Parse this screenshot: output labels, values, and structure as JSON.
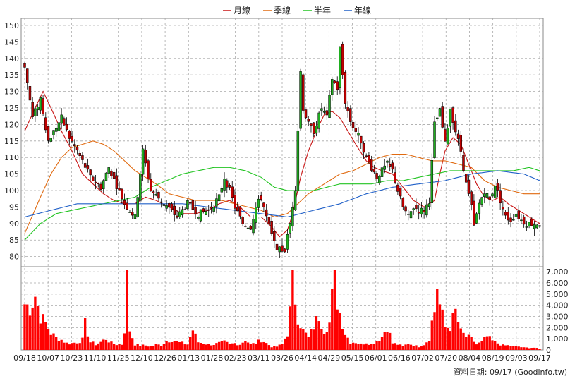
{
  "chart_data": {
    "type": "candlestick",
    "title": "",
    "legend": {
      "placement": "top-center",
      "items": [
        {
          "label": "月線",
          "color": "#c81414"
        },
        {
          "label": "季線",
          "color": "#e06a10"
        },
        {
          "label": "半年",
          "color": "#22c422"
        },
        {
          "label": "年線",
          "color": "#2060c8"
        }
      ]
    },
    "price_axis": {
      "ylim": [
        78,
        150
      ],
      "ticks": [
        80,
        85,
        90,
        95,
        100,
        105,
        110,
        115,
        120,
        125,
        130,
        135,
        140,
        145,
        150
      ],
      "placement": "left"
    },
    "volume_axis": {
      "ylim": [
        0,
        7200
      ],
      "ticks": [
        "0",
        "1,000",
        "2,000",
        "3,000",
        "4,000",
        "5,000",
        "6,000",
        "7,000"
      ],
      "tick_values": [
        0,
        1000,
        2000,
        3000,
        4000,
        5000,
        6000,
        7000
      ],
      "placement": "right"
    },
    "grid": true,
    "x_ticks": [
      "09/18",
      "10/07",
      "10/23",
      "11/10",
      "11/25",
      "12/10",
      "12/26",
      "01/13",
      "01/28",
      "02/23",
      "03/11",
      "03/26",
      "04/14",
      "04/29",
      "05/15",
      "06/01",
      "06/16",
      "07/02",
      "07/20",
      "08/04",
      "08/19",
      "09/03",
      "09/17"
    ],
    "colors": {
      "up": "#1fae1f",
      "down": "#c00000",
      "volume": "#ff0000",
      "grid": "#a8a8a8"
    },
    "close_anchors": [
      [
        0,
        138
      ],
      [
        3,
        122
      ],
      [
        6,
        128
      ],
      [
        9,
        115
      ],
      [
        14,
        122
      ],
      [
        17,
        116
      ],
      [
        20,
        112
      ],
      [
        25,
        104
      ],
      [
        29,
        101
      ],
      [
        32,
        107
      ],
      [
        38,
        96
      ],
      [
        42,
        92
      ],
      [
        45,
        112
      ],
      [
        48,
        100
      ],
      [
        52,
        97
      ],
      [
        58,
        92
      ],
      [
        62,
        96
      ],
      [
        66,
        93
      ],
      [
        70,
        94
      ],
      [
        74,
        98
      ],
      [
        76,
        104
      ],
      [
        78,
        100
      ],
      [
        80,
        95
      ],
      [
        83,
        90
      ],
      [
        86,
        89
      ],
      [
        88,
        95
      ],
      [
        90,
        98
      ],
      [
        93,
        89
      ],
      [
        95,
        84
      ],
      [
        97,
        82
      ],
      [
        99,
        82
      ],
      [
        101,
        90
      ],
      [
        103,
        101
      ],
      [
        105,
        136
      ],
      [
        106,
        125
      ],
      [
        108,
        120
      ],
      [
        110,
        118
      ],
      [
        113,
        125
      ],
      [
        115,
        122
      ],
      [
        117,
        134
      ],
      [
        119,
        131
      ],
      [
        120,
        143
      ],
      [
        122,
        127
      ],
      [
        124,
        121
      ],
      [
        126,
        118
      ],
      [
        128,
        115
      ],
      [
        130,
        110
      ],
      [
        132,
        107
      ],
      [
        134,
        104
      ],
      [
        136,
        106
      ],
      [
        138,
        108
      ],
      [
        140,
        106
      ],
      [
        142,
        100
      ],
      [
        144,
        95
      ],
      [
        146,
        92
      ],
      [
        148,
        95
      ],
      [
        150,
        94
      ],
      [
        152,
        94
      ],
      [
        154,
        97
      ],
      [
        156,
        120
      ],
      [
        158,
        124
      ],
      [
        160,
        114
      ],
      [
        162,
        125
      ],
      [
        164,
        118
      ],
      [
        166,
        112
      ],
      [
        168,
        102
      ],
      [
        170,
        95
      ],
      [
        171,
        89
      ],
      [
        173,
        96
      ],
      [
        175,
        100
      ],
      [
        177,
        97
      ],
      [
        179,
        102
      ],
      [
        181,
        97
      ],
      [
        183,
        92
      ],
      [
        185,
        91
      ],
      [
        187,
        93
      ],
      [
        189,
        91
      ],
      [
        191,
        90
      ],
      [
        194,
        90
      ],
      [
        196,
        90
      ]
    ],
    "volume_anchors": [
      [
        0,
        4100
      ],
      [
        2,
        3800
      ],
      [
        4,
        4900
      ],
      [
        6,
        3000
      ],
      [
        8,
        2400
      ],
      [
        10,
        1500
      ],
      [
        12,
        1100
      ],
      [
        14,
        900
      ],
      [
        16,
        600
      ],
      [
        18,
        600
      ],
      [
        20,
        700
      ],
      [
        22,
        900
      ],
      [
        23,
        2300
      ],
      [
        25,
        700
      ],
      [
        27,
        500
      ],
      [
        29,
        700
      ],
      [
        31,
        1000
      ],
      [
        33,
        600
      ],
      [
        35,
        500
      ],
      [
        37,
        500
      ],
      [
        38,
        1800
      ],
      [
        39,
        7000
      ],
      [
        40,
        1800
      ],
      [
        42,
        500
      ],
      [
        44,
        400
      ],
      [
        46,
        400
      ],
      [
        48,
        300
      ],
      [
        50,
        500
      ],
      [
        52,
        400
      ],
      [
        54,
        800
      ],
      [
        56,
        900
      ],
      [
        58,
        700
      ],
      [
        60,
        600
      ],
      [
        62,
        500
      ],
      [
        64,
        1800
      ],
      [
        66,
        700
      ],
      [
        68,
        600
      ],
      [
        70,
        500
      ],
      [
        72,
        500
      ],
      [
        74,
        600
      ],
      [
        76,
        700
      ],
      [
        78,
        500
      ],
      [
        80,
        600
      ],
      [
        82,
        500
      ],
      [
        84,
        900
      ],
      [
        86,
        500
      ],
      [
        88,
        600
      ],
      [
        90,
        900
      ],
      [
        92,
        600
      ],
      [
        94,
        300
      ],
      [
        96,
        300
      ],
      [
        98,
        500
      ],
      [
        100,
        1500
      ],
      [
        101,
        3400
      ],
      [
        102,
        6200
      ],
      [
        104,
        3000
      ],
      [
        106,
        1700
      ],
      [
        108,
        1100
      ],
      [
        110,
        2100
      ],
      [
        112,
        3100
      ],
      [
        114,
        1800
      ],
      [
        116,
        2400
      ],
      [
        118,
        7000
      ],
      [
        119,
        4400
      ],
      [
        120,
        3300
      ],
      [
        122,
        1500
      ],
      [
        124,
        700
      ],
      [
        126,
        700
      ],
      [
        128,
        500
      ],
      [
        130,
        700
      ],
      [
        132,
        500
      ],
      [
        134,
        800
      ],
      [
        136,
        1200
      ],
      [
        138,
        2100
      ],
      [
        140,
        600
      ],
      [
        142,
        500
      ],
      [
        144,
        300
      ],
      [
        146,
        600
      ],
      [
        148,
        400
      ],
      [
        150,
        300
      ],
      [
        152,
        500
      ],
      [
        154,
        1000
      ],
      [
        155,
        2500
      ],
      [
        156,
        3500
      ],
      [
        157,
        5800
      ],
      [
        158,
        4000
      ],
      [
        160,
        2000
      ],
      [
        162,
        2100
      ],
      [
        164,
        3400
      ],
      [
        166,
        1600
      ],
      [
        168,
        1200
      ],
      [
        170,
        1000
      ],
      [
        172,
        500
      ],
      [
        174,
        700
      ],
      [
        176,
        1200
      ],
      [
        178,
        800
      ],
      [
        180,
        600
      ],
      [
        182,
        400
      ],
      [
        184,
        400
      ],
      [
        186,
        300
      ],
      [
        188,
        300
      ],
      [
        190,
        200
      ],
      [
        192,
        200
      ],
      [
        194,
        200
      ],
      [
        196,
        100
      ]
    ],
    "moving_averages": {
      "月線": [
        [
          0,
          118
        ],
        [
          4,
          125
        ],
        [
          7,
          130
        ],
        [
          10,
          125
        ],
        [
          14,
          118
        ],
        [
          18,
          112
        ],
        [
          22,
          105
        ],
        [
          26,
          102
        ],
        [
          30,
          99
        ],
        [
          34,
          97
        ],
        [
          38,
          96
        ],
        [
          42,
          96
        ],
        [
          46,
          98
        ],
        [
          50,
          97
        ],
        [
          55,
          95
        ],
        [
          60,
          93
        ],
        [
          65,
          93
        ],
        [
          70,
          94
        ],
        [
          74,
          96
        ],
        [
          78,
          97
        ],
        [
          82,
          95
        ],
        [
          86,
          92
        ],
        [
          90,
          92
        ],
        [
          94,
          89
        ],
        [
          97,
          86
        ],
        [
          100,
          88
        ],
        [
          102,
          93
        ],
        [
          105,
          104
        ],
        [
          108,
          112
        ],
        [
          111,
          118
        ],
        [
          114,
          123
        ],
        [
          117,
          124
        ],
        [
          120,
          122
        ],
        [
          123,
          118
        ],
        [
          126,
          114
        ],
        [
          130,
          109
        ],
        [
          133,
          107
        ],
        [
          136,
          106
        ],
        [
          140,
          105
        ],
        [
          144,
          101
        ],
        [
          148,
          97
        ],
        [
          152,
          95
        ],
        [
          156,
          97
        ],
        [
          158,
          105
        ],
        [
          160,
          112
        ],
        [
          163,
          116
        ],
        [
          166,
          114
        ],
        [
          169,
          108
        ],
        [
          172,
          102
        ],
        [
          175,
          98
        ],
        [
          178,
          97
        ],
        [
          181,
          98
        ],
        [
          184,
          96
        ],
        [
          188,
          94
        ],
        [
          192,
          92
        ],
        [
          196,
          90
        ]
      ],
      "季線": [
        [
          0,
          87
        ],
        [
          6,
          98
        ],
        [
          10,
          105
        ],
        [
          14,
          110
        ],
        [
          18,
          113
        ],
        [
          22,
          114
        ],
        [
          26,
          115
        ],
        [
          30,
          114
        ],
        [
          34,
          112
        ],
        [
          38,
          109
        ],
        [
          42,
          106
        ],
        [
          46,
          104
        ],
        [
          50,
          102
        ],
        [
          55,
          99
        ],
        [
          60,
          98
        ],
        [
          65,
          97
        ],
        [
          70,
          97
        ],
        [
          75,
          97
        ],
        [
          80,
          96
        ],
        [
          85,
          95
        ],
        [
          90,
          94
        ],
        [
          95,
          92
        ],
        [
          100,
          93
        ],
        [
          104,
          96
        ],
        [
          108,
          99
        ],
        [
          112,
          101
        ],
        [
          116,
          103
        ],
        [
          120,
          105
        ],
        [
          125,
          106
        ],
        [
          130,
          108
        ],
        [
          135,
          110
        ],
        [
          140,
          111
        ],
        [
          145,
          111
        ],
        [
          150,
          110
        ],
        [
          155,
          109
        ],
        [
          160,
          109
        ],
        [
          165,
          108
        ],
        [
          170,
          107
        ],
        [
          175,
          103
        ],
        [
          180,
          101
        ],
        [
          185,
          100
        ],
        [
          190,
          99
        ],
        [
          196,
          99
        ]
      ],
      "半年": [
        [
          0,
          85
        ],
        [
          6,
          90
        ],
        [
          12,
          93
        ],
        [
          18,
          94
        ],
        [
          24,
          95
        ],
        [
          30,
          96
        ],
        [
          36,
          97
        ],
        [
          42,
          98
        ],
        [
          48,
          101
        ],
        [
          54,
          103
        ],
        [
          60,
          105
        ],
        [
          66,
          106
        ],
        [
          72,
          107
        ],
        [
          78,
          107
        ],
        [
          84,
          106
        ],
        [
          90,
          104
        ],
        [
          95,
          101
        ],
        [
          100,
          100
        ],
        [
          104,
          100
        ],
        [
          110,
          100
        ],
        [
          115,
          101
        ],
        [
          120,
          102
        ],
        [
          126,
          102
        ],
        [
          132,
          102
        ],
        [
          138,
          103
        ],
        [
          144,
          103
        ],
        [
          150,
          104
        ],
        [
          156,
          105
        ],
        [
          162,
          106
        ],
        [
          168,
          106
        ],
        [
          174,
          106
        ],
        [
          180,
          106
        ],
        [
          186,
          106
        ],
        [
          192,
          107
        ],
        [
          196,
          106
        ]
      ],
      "年線": [
        [
          0,
          92
        ],
        [
          10,
          94
        ],
        [
          20,
          96
        ],
        [
          30,
          96
        ],
        [
          40,
          96
        ],
        [
          50,
          96
        ],
        [
          60,
          96
        ],
        [
          70,
          95
        ],
        [
          80,
          94
        ],
        [
          90,
          93
        ],
        [
          100,
          92
        ],
        [
          110,
          94
        ],
        [
          120,
          96
        ],
        [
          130,
          99
        ],
        [
          140,
          101
        ],
        [
          150,
          102
        ],
        [
          160,
          103
        ],
        [
          170,
          105
        ],
        [
          180,
          106
        ],
        [
          190,
          105
        ],
        [
          196,
          103
        ]
      ]
    },
    "footer_note": "資料日期: 09/17  (Goodinfo.tw)"
  }
}
